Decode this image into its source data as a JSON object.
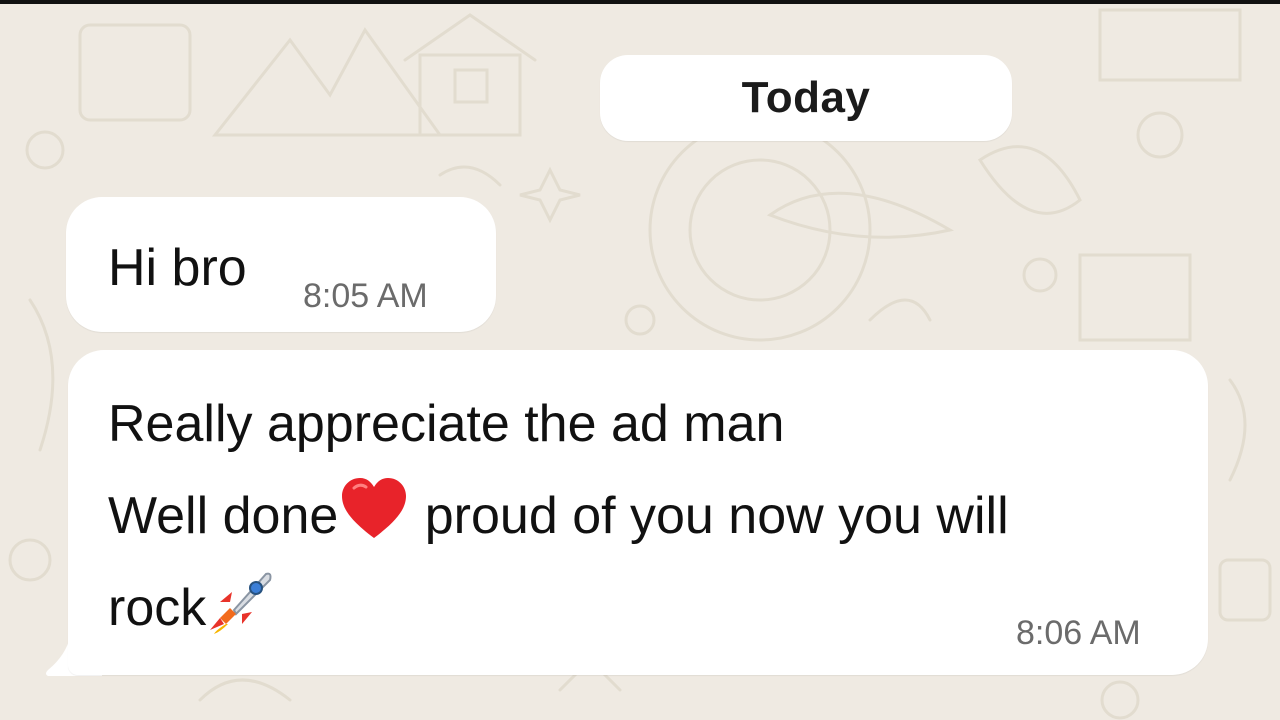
{
  "date_separator": "Today",
  "messages": [
    {
      "lines": [
        "Hi bro"
      ],
      "time": "8:05 AM"
    },
    {
      "line1": "Really appreciate the ad man",
      "line2_a": "Well done",
      "line2_b": " proud of you now you will",
      "line3": "rock",
      "time": "8:06 AM"
    }
  ],
  "emojis": [
    "heart-emoji",
    "rocket-emoji"
  ],
  "colors": {
    "background": "#efeae2",
    "bubble": "#ffffff",
    "timestamp": "#6b6b6b",
    "heart": "#e8232a"
  }
}
